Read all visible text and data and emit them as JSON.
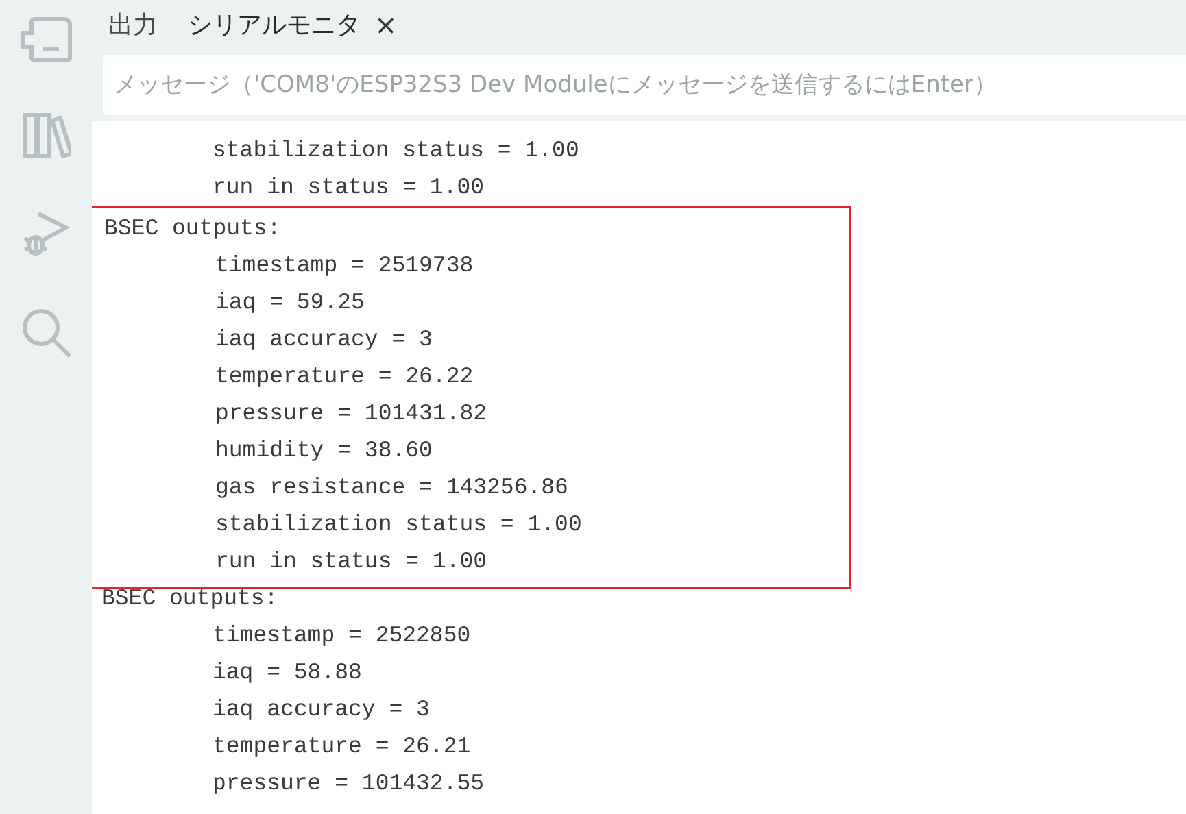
{
  "tabs": [
    {
      "label": "出力",
      "selected": false
    },
    {
      "label": "シリアルモニタ",
      "selected": true,
      "close": "×"
    }
  ],
  "message_field": {
    "placeholder": "メッセージ（'COM8'のESP32S3 Dev Moduleにメッセージを送信するにはEnter）"
  },
  "output": [
    {
      "highlighted": false,
      "lines": [
        {
          "kind": "field",
          "text": "stabilization status = 1.00"
        },
        {
          "kind": "field",
          "text": "run in status = 1.00"
        }
      ]
    },
    {
      "highlighted": true,
      "lines": [
        {
          "kind": "header",
          "text": "BSEC outputs:"
        },
        {
          "kind": "field",
          "text": "timestamp = 2519738"
        },
        {
          "kind": "field",
          "text": "iaq = 59.25"
        },
        {
          "kind": "field",
          "text": "iaq accuracy = 3"
        },
        {
          "kind": "field",
          "text": "temperature = 26.22"
        },
        {
          "kind": "field",
          "text": "pressure = 101431.82"
        },
        {
          "kind": "field",
          "text": "humidity = 38.60"
        },
        {
          "kind": "field",
          "text": "gas resistance = 143256.86"
        },
        {
          "kind": "field",
          "text": "stabilization status = 1.00"
        },
        {
          "kind": "field",
          "text": "run in status = 1.00"
        }
      ]
    },
    {
      "highlighted": false,
      "lines": [
        {
          "kind": "header",
          "text": "BSEC outputs:"
        },
        {
          "kind": "field",
          "text": "timestamp = 2522850"
        },
        {
          "kind": "field",
          "text": "iaq = 58.88"
        },
        {
          "kind": "field",
          "text": "iaq accuracy = 3"
        },
        {
          "kind": "field",
          "text": "temperature = 26.21"
        },
        {
          "kind": "field",
          "text": "pressure = 101432.55"
        }
      ]
    }
  ]
}
